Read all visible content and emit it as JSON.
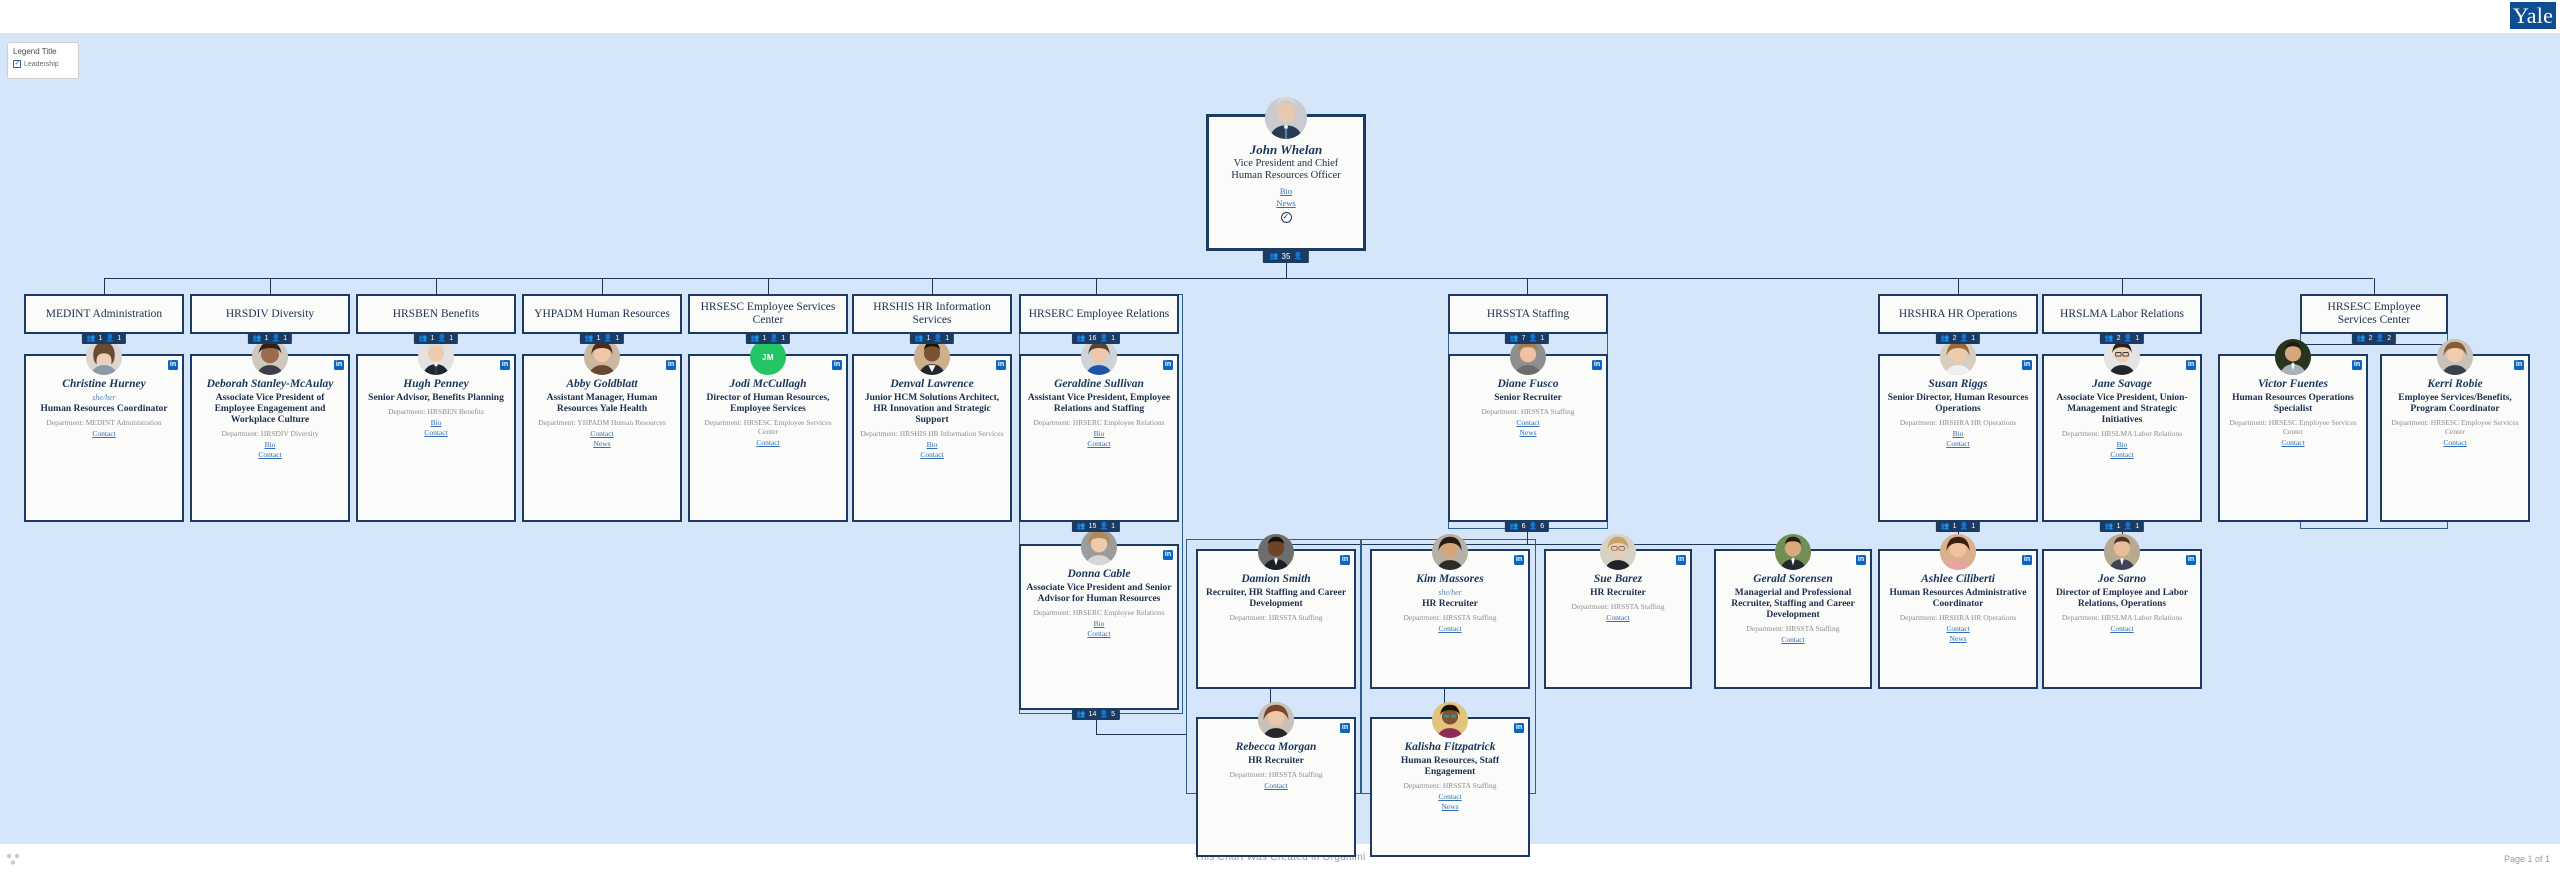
{
  "header": {
    "logo_text": "Yale"
  },
  "legend": {
    "title": "Legend Title",
    "items": [
      {
        "label": "Leadership",
        "icon": "check-square-icon"
      }
    ]
  },
  "footer": {
    "credit": "This Chart Was Created in Organimi",
    "page": "Page 1 of 1"
  },
  "root": {
    "name": "John Whelan",
    "title": "Vice President and Chief Human Resources Officer",
    "links": [
      "Bio",
      "News"
    ],
    "leader_icon": "check-circle-icon",
    "counts": {
      "group": "35",
      "person": ""
    }
  },
  "departments": [
    {
      "id": "medint",
      "name": "MEDINT Administration",
      "counts": {
        "group": "1",
        "person": "1"
      }
    },
    {
      "id": "hrsdiv",
      "name": "HRSDIV Diversity",
      "counts": {
        "group": "1",
        "person": "1"
      }
    },
    {
      "id": "hrsben",
      "name": "HRSBEN Benefits",
      "counts": {
        "group": "1",
        "person": "1"
      }
    },
    {
      "id": "yhpadm",
      "name": "YHPADM Human Resources",
      "counts": {
        "group": "1",
        "person": "1"
      }
    },
    {
      "id": "hrsesc1",
      "name": "HRSESC Employee Services Center",
      "counts": {
        "group": "1",
        "person": "1"
      }
    },
    {
      "id": "hrshis",
      "name": "HRSHIS HR Information Services",
      "counts": {
        "group": "1",
        "person": "1"
      }
    },
    {
      "id": "hrserc",
      "name": "HRSERC Employee Relations",
      "counts": {
        "group": "16",
        "person": "1"
      }
    },
    {
      "id": "hrssta",
      "name": "HRSSTA Staffing",
      "counts": {
        "group": "7",
        "person": "1"
      }
    },
    {
      "id": "hrshra",
      "name": "HRSHRA HR Operations",
      "counts": {
        "group": "2",
        "person": "1"
      }
    },
    {
      "id": "hrslma",
      "name": "HRSLMA Labor Relations",
      "counts": {
        "group": "2",
        "person": "1"
      }
    },
    {
      "id": "hrsesc2",
      "name": "HRSESC Employee Services Center",
      "counts": {
        "group": "2",
        "person": "2"
      }
    }
  ],
  "people": [
    {
      "id": "christine",
      "name": "Christine Hurney",
      "pronouns": "she/her",
      "title": "Human Resources Coordinator",
      "department": "Department: MEDINT Administration",
      "links": [
        "Contact"
      ],
      "avatar_type": "photo",
      "linkedin": true
    },
    {
      "id": "deborah",
      "name": "Deborah Stanley-McAulay",
      "pronouns": "",
      "title": "Associate Vice President of Employee Engagement and Workplace Culture",
      "department": "Department: HRSDIV Diversity",
      "links": [
        "Bio",
        "Contact"
      ],
      "avatar_type": "photo",
      "linkedin": true
    },
    {
      "id": "hugh",
      "name": "Hugh Penney",
      "pronouns": "",
      "title": "Senior Advisor, Benefits Planning",
      "department": "Department: HRSBEN Benefits",
      "links": [
        "Bio",
        "Contact"
      ],
      "avatar_type": "photo",
      "linkedin": true
    },
    {
      "id": "abby",
      "name": "Abby Goldblatt",
      "pronouns": "",
      "title": "Assistant Manager, Human Resources Yale Health",
      "department": "Department: YHPADM Human Resources",
      "links": [
        "Contact",
        "News"
      ],
      "avatar_type": "photo",
      "linkedin": true
    },
    {
      "id": "jodi",
      "name": "Jodi McCullagh",
      "pronouns": "",
      "title": "Director of Human Resources, Employee Services",
      "department": "Department: HRSESC Employee Services Center",
      "links": [
        "Contact"
      ],
      "avatar_type": "initials",
      "initials": "JM",
      "avatar_color": "#23c464",
      "linkedin": true
    },
    {
      "id": "denval",
      "name": "Denval Lawrence",
      "pronouns": "",
      "title": "Junior HCM Solutions Architect, HR Innovation and Strategic Support",
      "department": "Department: HRSHIS HR Information Services",
      "links": [
        "Bio",
        "Contact"
      ],
      "avatar_type": "photo",
      "linkedin": true
    },
    {
      "id": "geraldine",
      "name": "Geraldine Sullivan",
      "pronouns": "",
      "title": "Assistant Vice President, Employee Relations and Staffing",
      "department": "Department: HRSERC Employee Relations",
      "links": [
        "Bio",
        "Contact"
      ],
      "avatar_type": "photo",
      "linkedin": true,
      "counts": {
        "group": "15",
        "person": "1"
      }
    },
    {
      "id": "donna",
      "name": "Donna Cable",
      "pronouns": "",
      "title": "Associate Vice President and Senior Advisor for Human Resources",
      "department": "Department: HRSERC Employee Relations",
      "links": [
        "Bio",
        "Contact"
      ],
      "avatar_type": "photo",
      "linkedin": true,
      "counts": {
        "group": "14",
        "person": "5"
      }
    },
    {
      "id": "damion",
      "name": "Damion Smith",
      "pronouns": "",
      "title": "Recruiter, HR Staffing and Career Development",
      "department": "Department: HRSSTA Staffing",
      "links": [],
      "avatar_type": "photo",
      "linkedin": true
    },
    {
      "id": "rebecca",
      "name": "Rebecca Morgan",
      "pronouns": "",
      "title": "HR Recruiter",
      "department": "Department: HRSSTA Staffing",
      "links": [
        "Contact"
      ],
      "avatar_type": "photo",
      "linkedin": true
    },
    {
      "id": "diane",
      "name": "Diane Fusco",
      "pronouns": "",
      "title": "Senior Recruiter",
      "department": "Department: HRSSTA Staffing",
      "links": [
        "Contact",
        "News"
      ],
      "avatar_type": "photo",
      "linkedin": true,
      "counts": {
        "group": "6",
        "person": "6"
      }
    },
    {
      "id": "kim",
      "name": "Kim Massores",
      "pronouns": "she/her",
      "title": "HR Recruiter",
      "department": "Department: HRSSTA Staffing",
      "links": [
        "Contact"
      ],
      "avatar_type": "photo",
      "linkedin": true
    },
    {
      "id": "kalisha",
      "name": "Kalisha Fitzpatrick",
      "pronouns": "",
      "title": "Human Resources, Staff Engagement",
      "department": "Department: HRSSTA Staffing",
      "links": [
        "Contact",
        "News"
      ],
      "avatar_type": "photo",
      "linkedin": true
    },
    {
      "id": "sue",
      "name": "Sue Barez",
      "pronouns": "",
      "title": "HR Recruiter",
      "department": "Department: HRSSTA Staffing",
      "links": [
        "Contact"
      ],
      "avatar_type": "photo",
      "linkedin": true
    },
    {
      "id": "gerald",
      "name": "Gerald Sorensen",
      "pronouns": "",
      "title": "Managerial and Professional Recruiter, Staffing and Career Development",
      "department": "Department: HRSSTA Staffing",
      "links": [
        "Contact"
      ],
      "avatar_type": "photo",
      "linkedin": true
    },
    {
      "id": "susan",
      "name": "Susan Riggs",
      "pronouns": "",
      "title": "Senior Director, Human Resources Operations",
      "department": "Department: HRSHRA HR Operations",
      "links": [
        "Bio",
        "Contact"
      ],
      "avatar_type": "photo",
      "linkedin": true,
      "counts": {
        "group": "1",
        "person": "1"
      }
    },
    {
      "id": "ashlee",
      "name": "Ashlee Ciliberti",
      "pronouns": "",
      "title": "Human Resources Administrative Coordinator",
      "department": "Department: HRSHRA HR Operations",
      "links": [
        "Contact",
        "News"
      ],
      "avatar_type": "photo",
      "linkedin": true
    },
    {
      "id": "jane",
      "name": "Jane Savage",
      "pronouns": "",
      "title": "Associate Vice President, Union-Management and Strategic Initiatives",
      "department": "Department: HRSLMA Labor Relations",
      "links": [
        "Bio",
        "Contact"
      ],
      "avatar_type": "photo",
      "linkedin": true,
      "counts": {
        "group": "1",
        "person": "1"
      }
    },
    {
      "id": "joe",
      "name": "Joe Sarno",
      "pronouns": "",
      "title": "Director of Employee and Labor Relations, Operations",
      "department": "Department: HRSLMA Labor Relations",
      "links": [
        "Contact"
      ],
      "avatar_type": "photo",
      "linkedin": true
    },
    {
      "id": "victor",
      "name": "Victor Fuentes",
      "pronouns": "",
      "title": "Human Resources Operations Specialist",
      "department": "Department: HRSESC Employee Services Center",
      "links": [
        "Contact"
      ],
      "avatar_type": "photo",
      "linkedin": true
    },
    {
      "id": "kerri",
      "name": "Kerri Robie",
      "pronouns": "",
      "title": "Employee Services/Benefits, Program Coordinator",
      "department": "Department: HRSESC Employee Services Center",
      "links": [
        "Contact"
      ],
      "avatar_type": "photo",
      "linkedin": true
    }
  ]
}
